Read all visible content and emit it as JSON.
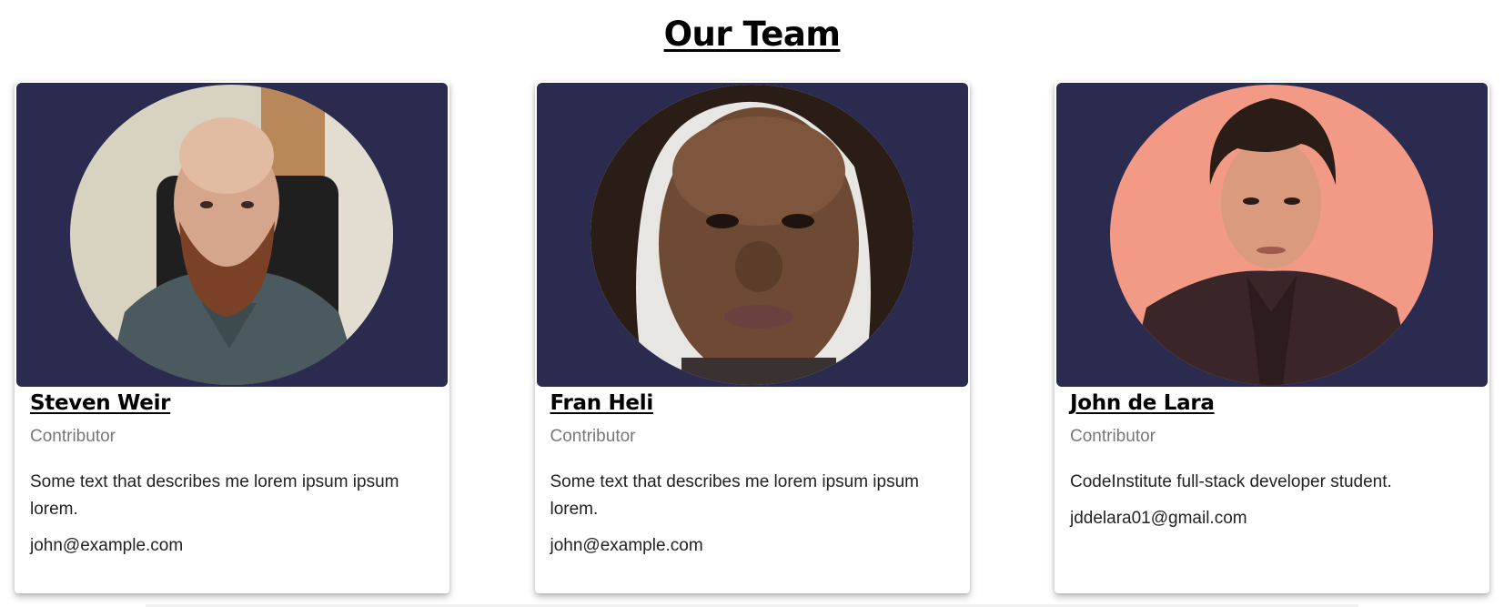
{
  "page": {
    "title": "Our Team"
  },
  "colors": {
    "photo_background": "#2b2b50",
    "role_text": "#777777"
  },
  "team": [
    {
      "name": "Steven Weir",
      "role": "Contributor",
      "description": "Some text that describes me lorem ipsum ipsum lorem.",
      "email": "john@example.com"
    },
    {
      "name": "Fran Heli",
      "role": "Contributor",
      "description": "Some text that describes me lorem ipsum ipsum lorem.",
      "email": "john@example.com"
    },
    {
      "name": "John de Lara",
      "role": "Contributor",
      "description": "CodeInstitute full-stack developer student.",
      "email": "jddelara01@gmail.com"
    }
  ]
}
